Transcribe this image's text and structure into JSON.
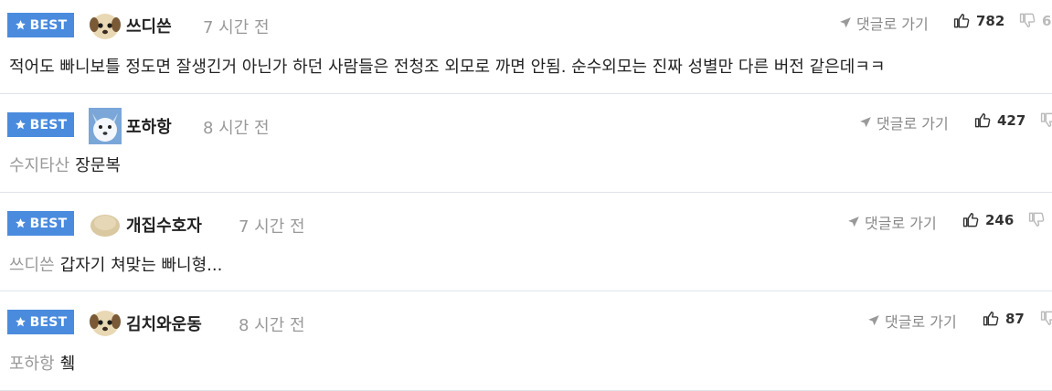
{
  "comments": [
    {
      "badge": "BEST",
      "avatar_icon": "puppy-avatar",
      "nickname": "쓰디쓴",
      "time": "7 시간 전",
      "reply_label": "댓글로 가기",
      "likes": "782",
      "dislikes": "6",
      "mention": "",
      "text": "적어도 빠니보틀 정도면 잘생긴거 아닌가 하던 사람들은 전청조 외모로 까면 안됨. 순수외모는 진짜 성별만 다른 버전 같은데ㅋㅋ"
    },
    {
      "badge": "BEST",
      "avatar_icon": "husky-avatar",
      "nickname": "포하항",
      "time": "8 시간 전",
      "reply_label": "댓글로 가기",
      "likes": "427",
      "dislikes": "",
      "mention": "수지타산",
      "text": "장문복"
    },
    {
      "badge": "BEST",
      "avatar_icon": "blob-avatar",
      "nickname": "개집수호자",
      "time": "7 시간 전",
      "reply_label": "댓글로 가기",
      "likes": "246",
      "dislikes": "",
      "mention": "쓰디쓴",
      "text": "갑자기 쳐맞는 빠니형..."
    },
    {
      "badge": "BEST",
      "avatar_icon": "puppy-avatar",
      "nickname": "김치와운동",
      "time": "8 시간 전",
      "reply_label": "댓글로 가기",
      "likes": "87",
      "dislikes": "",
      "mention": "포하항",
      "text": "췤"
    }
  ],
  "colors": {
    "badge": "#4a8bde",
    "divider": "#dfe3ea",
    "muted": "#999999"
  }
}
